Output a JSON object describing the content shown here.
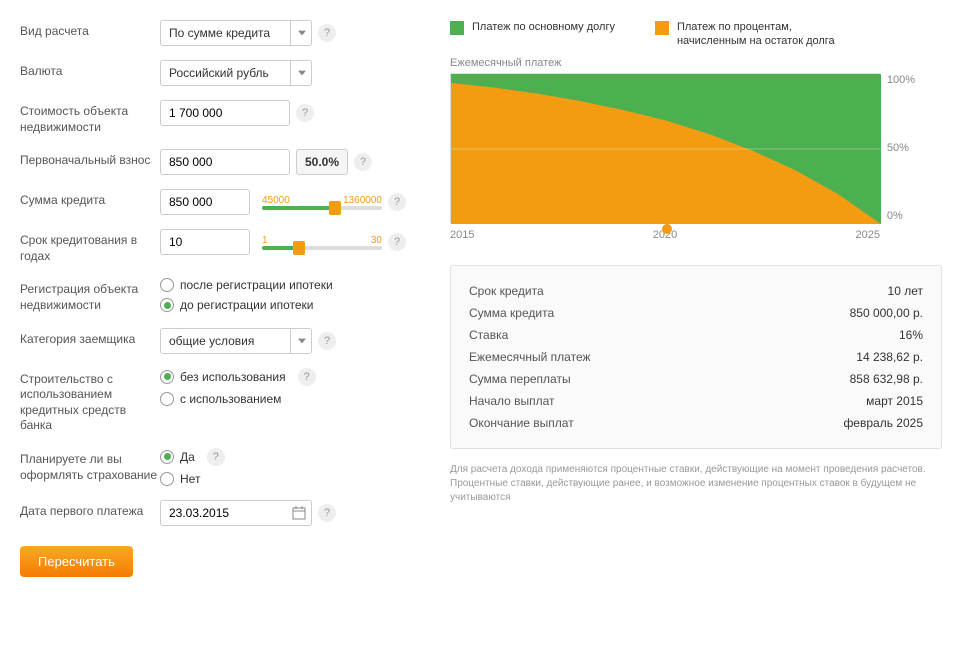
{
  "form": {
    "calc_type": {
      "label": "Вид расчета",
      "value": "По сумме кредита"
    },
    "currency": {
      "label": "Валюта",
      "value": "Российский рубль"
    },
    "property_cost": {
      "label": "Стоимость объекта недвижимости",
      "value": "1 700 000"
    },
    "down_payment": {
      "label": "Первоначальный взнос",
      "value": "850 000",
      "pct": "50.0%"
    },
    "loan_amount": {
      "label": "Сумма кредита",
      "value": "850 000",
      "min": "45000",
      "max": "1360000"
    },
    "loan_term": {
      "label": "Срок кредитования в годах",
      "value": "10",
      "min": "1",
      "max": "30"
    },
    "registration": {
      "label": "Регистрация объекта недвижимости",
      "opt1": "после регистрации ипотеки",
      "opt2": "до регистрации ипотеки"
    },
    "borrower_cat": {
      "label": "Категория заемщика",
      "value": "общие условия"
    },
    "construction": {
      "label": "Строительство с использованием кредитных средств банка",
      "opt1": "без использования",
      "opt2": "с использованием"
    },
    "insurance": {
      "label": "Планируете ли вы оформлять страхование",
      "opt1": "Да",
      "opt2": "Нет"
    },
    "first_payment": {
      "label": "Дата первого платежа",
      "value": "23.03.2015"
    },
    "recalc_btn": "Пересчитать"
  },
  "chart": {
    "legend1": "Платеж по основному долгу",
    "legend2": "Платеж по процентам, начисленным на остаток долга",
    "title": "Ежемесячный платеж",
    "ylabels": [
      "100%",
      "50%",
      "0%"
    ],
    "xlabels": [
      "2015",
      "2020",
      "2025"
    ]
  },
  "chart_data": {
    "type": "area",
    "title": "Ежемесячный платеж",
    "xlabel": "",
    "ylabel": "",
    "ylim": [
      0,
      100
    ],
    "x": [
      2015,
      2016,
      2017,
      2018,
      2019,
      2020,
      2021,
      2022,
      2023,
      2024,
      2025
    ],
    "series": [
      {
        "name": "Платеж по процентам, начисленным на остаток долга",
        "color": "#f39c12",
        "values": [
          94,
          91,
          87,
          82,
          76,
          69,
          60,
          49,
          36,
          20,
          0
        ]
      },
      {
        "name": "Платеж по основному долгу",
        "color": "#4caf50",
        "values": [
          6,
          9,
          13,
          18,
          24,
          31,
          40,
          51,
          64,
          80,
          100
        ]
      }
    ],
    "stacked_to_100": true
  },
  "summary": {
    "rows": [
      {
        "label": "Срок кредита",
        "value": "10 лет"
      },
      {
        "label": "Сумма кредита",
        "value": "850 000,00 р."
      },
      {
        "label": "Ставка",
        "value": "16%"
      },
      {
        "label": "Ежемесячный платеж",
        "value": "14 238,62 р."
      },
      {
        "label": "Сумма переплаты",
        "value": "858 632,98 р."
      },
      {
        "label": "Начало выплат",
        "value": "март 2015"
      },
      {
        "label": "Окончание выплат",
        "value": "февраль 2025"
      }
    ]
  },
  "disclaimer": "Для расчета дохода применяются процентные ставки, действующие на момент проведения расчетов. Процентные ставки, действующие ранее, и возможное изменение процентных ставок в будущем не учитываются"
}
